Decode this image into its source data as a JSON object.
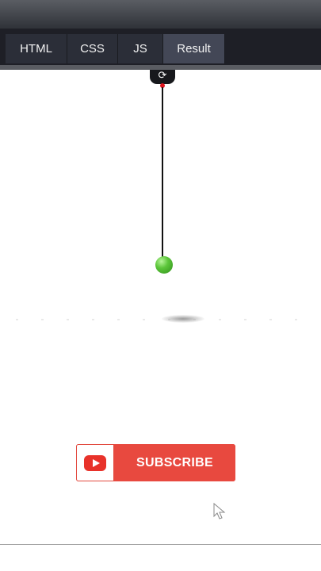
{
  "tabs": {
    "html": "HTML",
    "css": "CSS",
    "js": "JS",
    "result": "Result",
    "active": "Result"
  },
  "mount": {
    "glyph": "⟳"
  },
  "colors": {
    "tab_bar": "#1e1f26",
    "tab_active": "#434756",
    "ball": "#5cc63a",
    "pivot": "#e0141e",
    "subscribe": "#e8493f"
  },
  "icons": {
    "youtube": "youtube-icon",
    "cursor": "mouse-cursor-icon"
  },
  "subscribe": {
    "label": "SUBSCRIBE"
  }
}
